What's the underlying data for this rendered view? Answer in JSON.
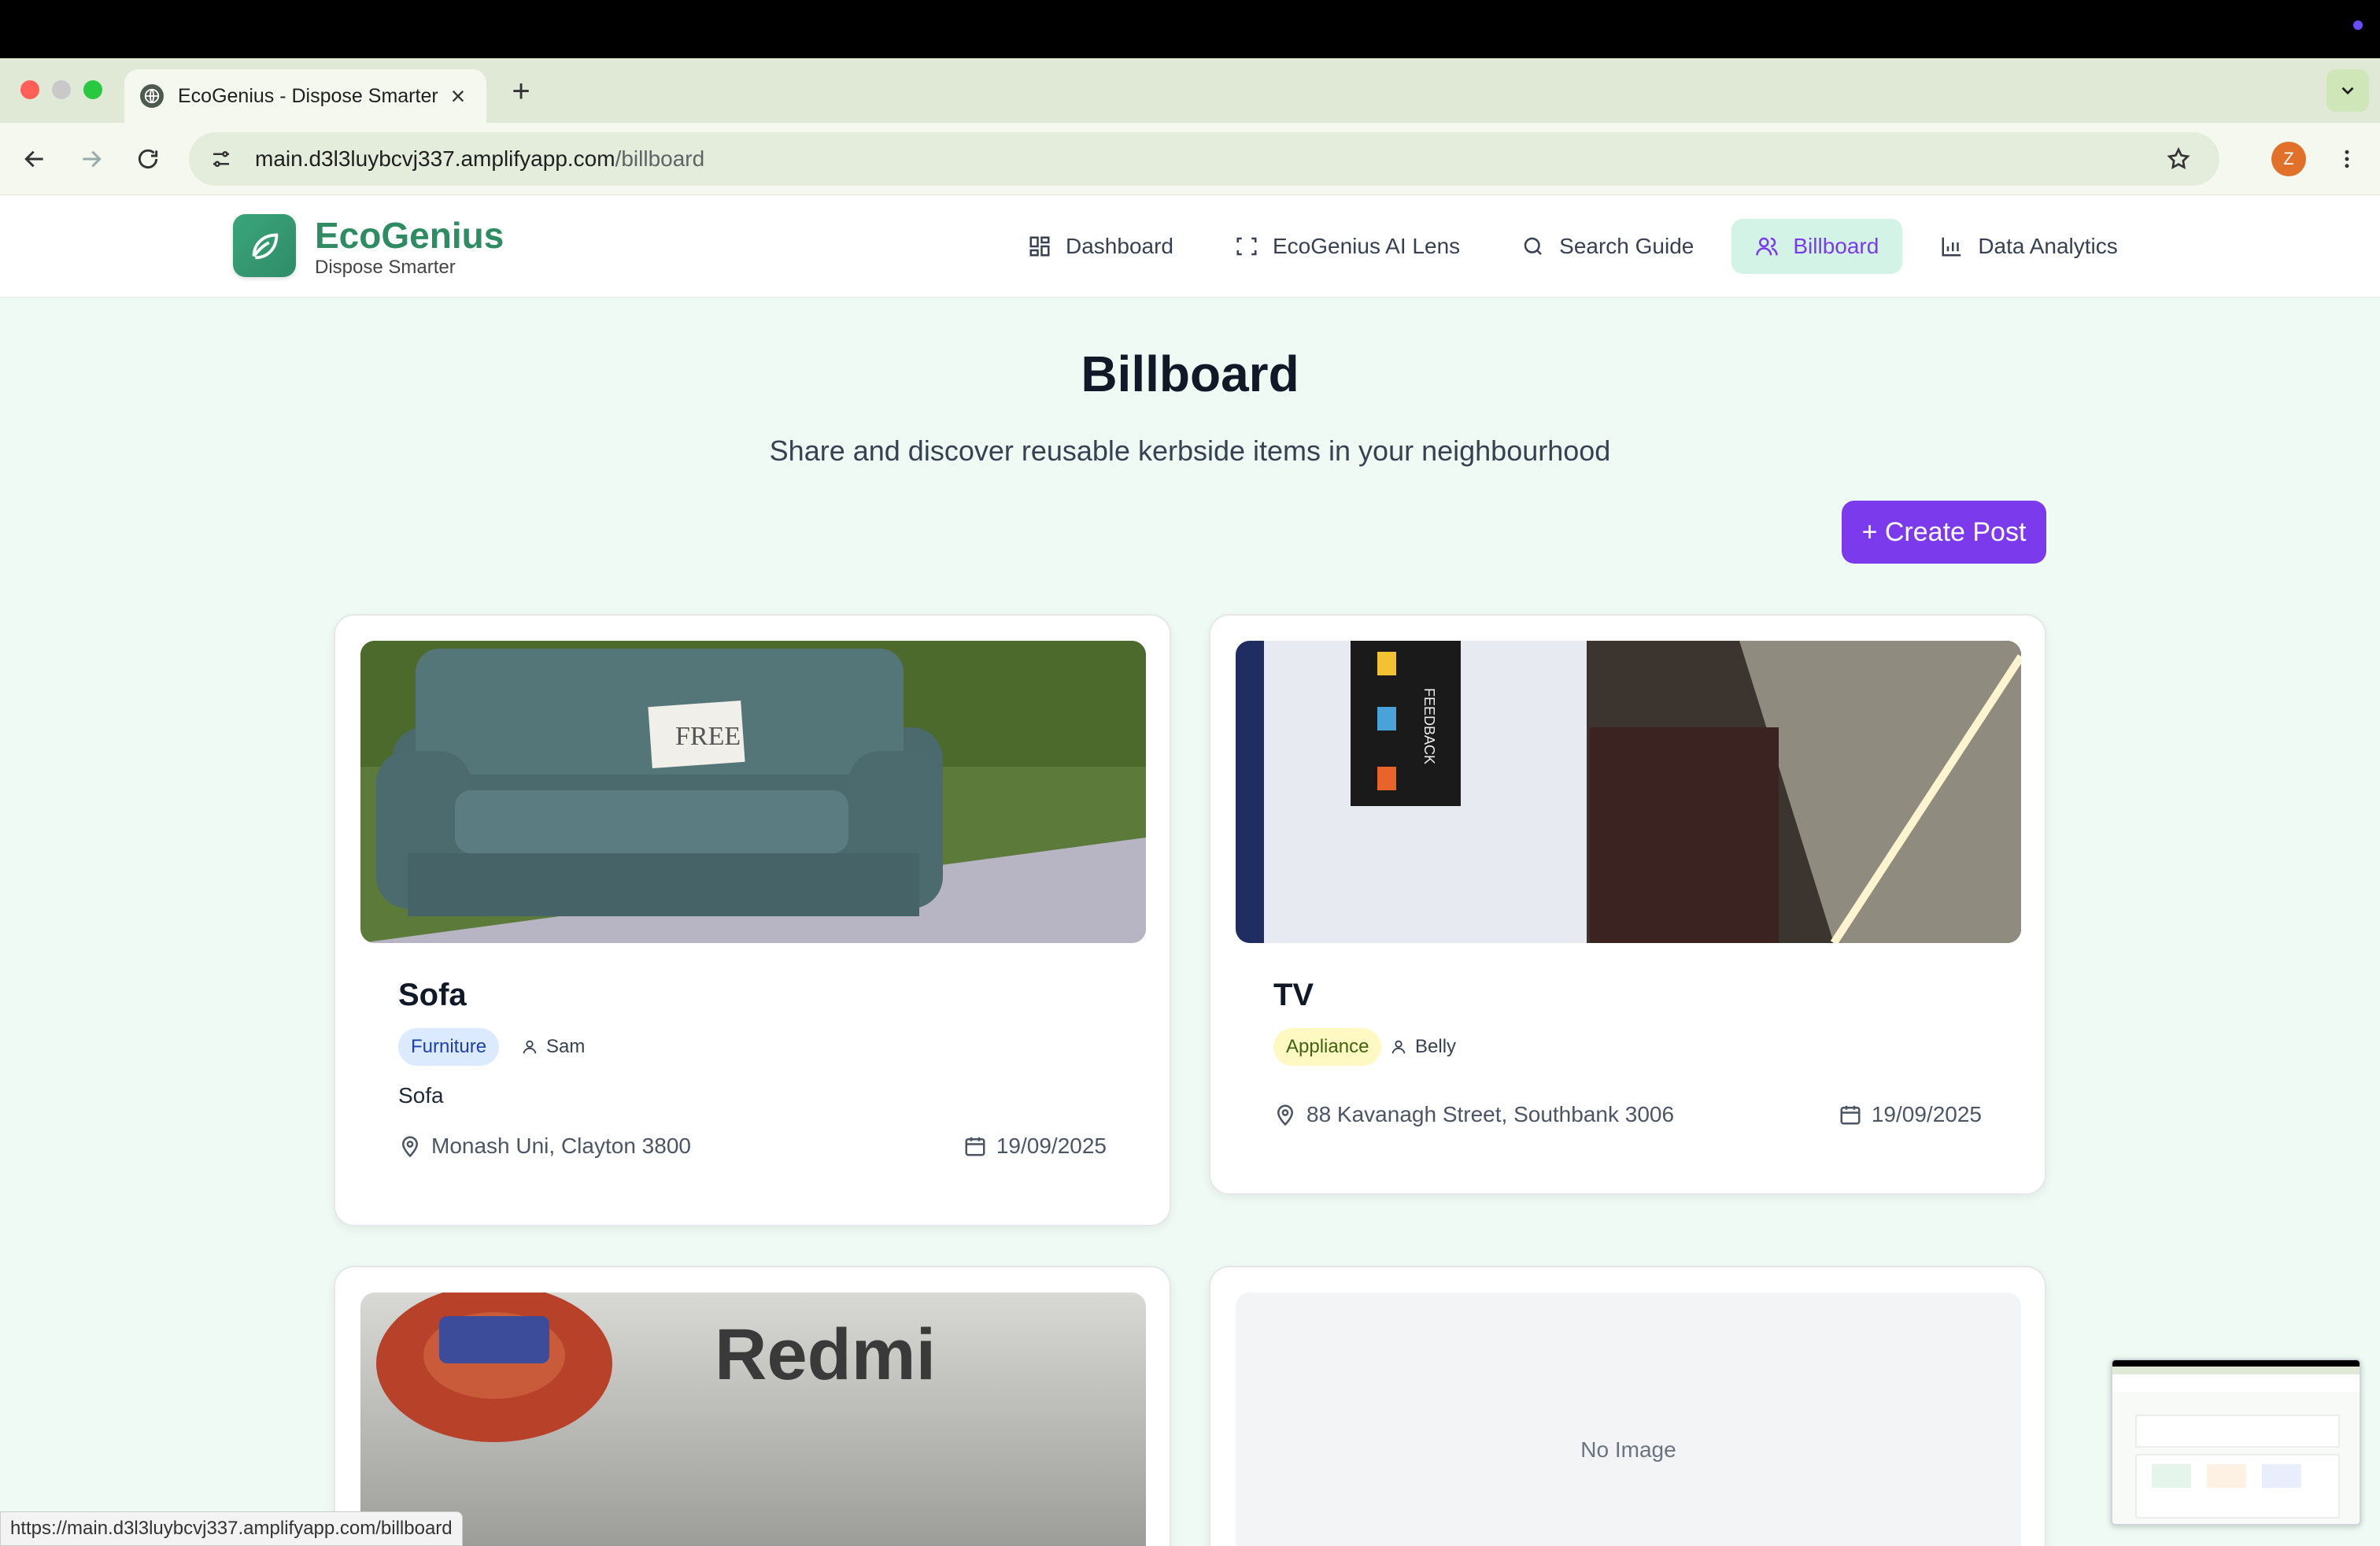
{
  "browser": {
    "tab_title": "EcoGenius - Dispose Smarter",
    "new_tab_label": "+",
    "url_host": "main.d3l3luybcvj337.amplifyapp.com",
    "url_path": "/billboard",
    "profile_initial": "Z",
    "status_url": "https://main.d3l3luybcvj337.amplifyapp.com/billboard"
  },
  "site": {
    "brand": "EcoGenius",
    "tagline": "Dispose Smarter",
    "nav": [
      {
        "label": "Dashboard",
        "icon": "grid-icon"
      },
      {
        "label": "EcoGenius AI Lens",
        "icon": "scan-icon"
      },
      {
        "label": "Search Guide",
        "icon": "search-icon"
      },
      {
        "label": "Billboard",
        "icon": "users-icon",
        "active": true
      },
      {
        "label": "Data Analytics",
        "icon": "bar-chart-icon"
      }
    ]
  },
  "page": {
    "title": "Billboard",
    "subtitle": "Share and discover reusable kerbside items in your neighbourhood",
    "create_label": "+ Create Post"
  },
  "posts": [
    {
      "title": "Sofa",
      "category": "Furniture",
      "owner": "Sam",
      "description": "Sofa",
      "location": "Monash Uni, Clayton 3800",
      "date": "19/09/2025",
      "image_sign": "FREE"
    },
    {
      "title": "TV",
      "category": "Appliance",
      "owner": "Belly",
      "description": "",
      "location": "88 Kavanagh Street, Southbank 3006",
      "date": "19/09/2025",
      "image_text": "FEEDBACK"
    },
    {
      "title": "",
      "image_text": "Redmi"
    },
    {
      "title": "",
      "placeholder": "No Image"
    }
  ],
  "colors": {
    "brand_green": "#2e8b62",
    "accent_purple": "#7c3aed",
    "nav_active_bg": "#d3f3e6",
    "page_bg": "#eefaf3"
  }
}
